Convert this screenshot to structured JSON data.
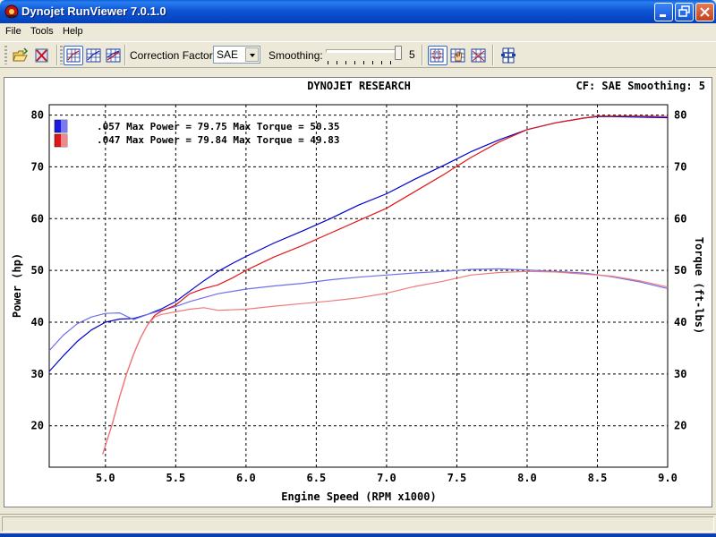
{
  "window": {
    "title": "Dynojet RunViewer 7.0.1.0",
    "minimize_icon": "minimize-icon",
    "maximize_icon": "restore-icon",
    "close_icon": "close-icon"
  },
  "menu": {
    "items": [
      {
        "label": "File"
      },
      {
        "label": "Tools"
      },
      {
        "label": "Help"
      }
    ]
  },
  "toolbar": {
    "correction_factor_label": "Correction Factor:",
    "correction_factor_value": "SAE",
    "smoothing_label": "Smoothing:",
    "smoothing_value": "5",
    "smoothing_fraction": 1.0,
    "icons": [
      "open-folder-icon",
      "close-file-icon",
      "graph-view-1-icon",
      "graph-view-2-icon",
      "graph-view-3-icon",
      "zoom-graph-icon",
      "pan-hand-icon",
      "crosshair-graph-icon",
      "run-files-icon"
    ]
  },
  "chart_header": {
    "title": "DYNOJET RESEARCH",
    "cf_info": "CF: SAE  Smoothing: 5"
  },
  "colors": {
    "run1": "#0000cc",
    "run1_light": "#6f6fea",
    "run2": "#e01818",
    "run2_light": "#f07a7a",
    "title_bar": "#0a5fd8"
  },
  "chart_data": {
    "type": "line",
    "title": "DYNOJET RESEARCH",
    "xlabel": "Engine Speed (RPM x1000)",
    "ylabel": "Power (hp)",
    "y2label": "Torque (ft-lbs)",
    "xlim": [
      4.6,
      9.0
    ],
    "ylim": [
      12,
      82
    ],
    "y2lim": [
      12,
      82
    ],
    "x_ticks": [
      "5.0",
      "5.5",
      "6.0",
      "6.5",
      "7.0",
      "7.5",
      "8.0",
      "8.5",
      "9.0"
    ],
    "y_ticks": [
      "20",
      "30",
      "40",
      "50",
      "60",
      "70",
      "80"
    ],
    "y2_ticks": [
      "20",
      "30",
      "40",
      "50",
      "60",
      "70",
      "80"
    ],
    "grid": true,
    "legend_position": "top-left",
    "legend": [
      {
        "text": ".057 Max Power = 79.75 Max Torque = 50.35",
        "color": "#0000cc"
      },
      {
        "text": ".047 Max Power = 79.84 Max Torque = 49.83",
        "color": "#e01818"
      }
    ],
    "series": [
      {
        "name": ".057 Power",
        "color": "#0000cc",
        "x": [
          4.6,
          4.7,
          4.8,
          4.9,
          5.0,
          5.1,
          5.2,
          5.3,
          5.4,
          5.5,
          5.6,
          5.7,
          5.8,
          5.9,
          6.0,
          6.2,
          6.4,
          6.6,
          6.8,
          7.0,
          7.2,
          7.4,
          7.6,
          7.8,
          8.0,
          8.2,
          8.4,
          8.5,
          8.6,
          8.8,
          9.0
        ],
        "values": [
          30.5,
          33.5,
          36.3,
          38.5,
          40.0,
          40.6,
          40.7,
          41.5,
          42.6,
          44.0,
          46.0,
          48.0,
          49.8,
          51.3,
          52.7,
          55.3,
          57.6,
          60.0,
          62.6,
          64.8,
          67.6,
          70.2,
          72.9,
          75.2,
          77.2,
          78.5,
          79.4,
          79.7,
          79.7,
          79.6,
          79.5
        ]
      },
      {
        "name": ".057 Torque",
        "color": "#6f6fea",
        "x": [
          4.6,
          4.7,
          4.8,
          4.9,
          5.0,
          5.1,
          5.2,
          5.3,
          5.4,
          5.5,
          5.6,
          5.8,
          6.0,
          6.2,
          6.4,
          6.6,
          6.8,
          7.0,
          7.2,
          7.4,
          7.6,
          7.8,
          8.0,
          8.2,
          8.4,
          8.6,
          8.8,
          9.0
        ],
        "values": [
          34.5,
          37.5,
          39.7,
          41.0,
          41.7,
          41.8,
          40.5,
          41.5,
          42.3,
          43.0,
          44.0,
          45.5,
          46.4,
          47.0,
          47.5,
          48.2,
          48.7,
          49.1,
          49.5,
          49.8,
          50.2,
          50.3,
          50.1,
          49.8,
          49.5,
          48.8,
          47.8,
          46.5
        ]
      },
      {
        "name": ".047 Power",
        "color": "#e01818",
        "x": [
          4.98,
          5.05,
          5.1,
          5.15,
          5.2,
          5.25,
          5.3,
          5.35,
          5.4,
          5.5,
          5.6,
          5.7,
          5.8,
          5.9,
          6.0,
          6.2,
          6.4,
          6.6,
          6.8,
          7.0,
          7.2,
          7.4,
          7.6,
          7.8,
          8.0,
          8.2,
          8.4,
          8.5,
          8.6,
          8.8,
          9.0
        ],
        "values": [
          14.5,
          20.5,
          25.5,
          30.0,
          33.8,
          37.0,
          39.5,
          41.3,
          42.2,
          43.3,
          45.5,
          46.5,
          47.2,
          48.5,
          50.0,
          52.6,
          54.8,
          57.2,
          59.6,
          62.0,
          65.2,
          68.4,
          71.8,
          74.8,
          77.2,
          78.5,
          79.4,
          79.8,
          79.8,
          79.8,
          79.7
        ]
      },
      {
        "name": ".047 Torque",
        "color": "#f07a7a",
        "x": [
          4.98,
          5.05,
          5.1,
          5.15,
          5.2,
          5.25,
          5.3,
          5.35,
          5.4,
          5.5,
          5.6,
          5.7,
          5.8,
          6.0,
          6.2,
          6.4,
          6.6,
          6.8,
          7.0,
          7.2,
          7.4,
          7.6,
          7.8,
          8.0,
          8.2,
          8.4,
          8.6,
          8.8,
          9.0
        ],
        "values": [
          14.5,
          20.5,
          25.5,
          30.0,
          33.8,
          37.0,
          39.5,
          41.0,
          41.5,
          42.0,
          42.5,
          42.8,
          42.3,
          42.5,
          43.1,
          43.6,
          44.1,
          44.7,
          45.6,
          46.9,
          47.9,
          49.1,
          49.6,
          49.8,
          49.7,
          49.3,
          48.9,
          48.0,
          46.8
        ]
      }
    ]
  }
}
